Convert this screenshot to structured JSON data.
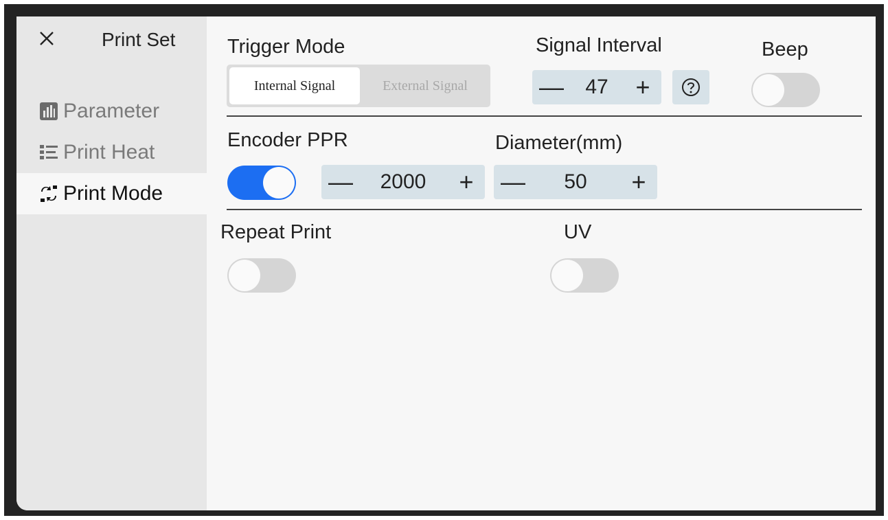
{
  "sidebar": {
    "title": "Print Set",
    "items": [
      {
        "label": "Parameter",
        "icon": "bar-chart-icon",
        "active": false
      },
      {
        "label": "Print Heat",
        "icon": "list-icon",
        "active": false
      },
      {
        "label": "Print Mode",
        "icon": "print-mode-icon",
        "active": true
      }
    ]
  },
  "trigger_mode": {
    "label": "Trigger Mode",
    "options": [
      "Internal Signal",
      "External Signal"
    ],
    "selected": "Internal Signal"
  },
  "signal_interval": {
    "label": "Signal Interval",
    "value": "47",
    "minus": "—",
    "plus": "+"
  },
  "beep": {
    "label": "Beep",
    "on": false
  },
  "encoder_ppr": {
    "label": "Encoder PPR",
    "on": true,
    "value": "2000",
    "minus": "—",
    "plus": "+"
  },
  "diameter": {
    "label": "Diameter(mm)",
    "value": "50",
    "minus": "—",
    "plus": "+"
  },
  "repeat_print": {
    "label": "Repeat Print",
    "on": false
  },
  "uv": {
    "label": "UV",
    "on": false
  },
  "colors": {
    "accent": "#1c6ef2",
    "stepper_bg": "#d7e2e8",
    "sidebar_bg": "#e7e7e7",
    "content_bg": "#f7f7f7"
  }
}
